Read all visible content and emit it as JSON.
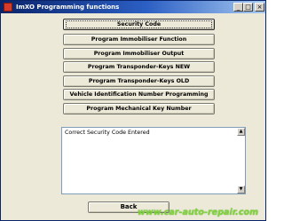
{
  "window": {
    "title": "ImXO Programming functions",
    "controls": {
      "minimize": "_",
      "maximize": "□",
      "close": "×"
    }
  },
  "menu": {
    "buttons": [
      "Security Code",
      "Program Immobiliser Function",
      "Program Immobiliser Output",
      "Program Transponder-Keys NEW",
      "Program Transponder-Keys OLD",
      "Vehicle Identification Number Programming",
      "Program Mechanical Key Number"
    ]
  },
  "status": {
    "text": "Correct Security Code Entered",
    "scroll_up": "▲",
    "scroll_down": "▼"
  },
  "footer": {
    "back_label": "Back"
  },
  "watermark": "www.car-auto-repair.com",
  "colors": {
    "titlebar_start": "#0a246a",
    "titlebar_end": "#a6caf0",
    "window_bg": "#ece9d8",
    "watermark": "#7fd63a"
  }
}
